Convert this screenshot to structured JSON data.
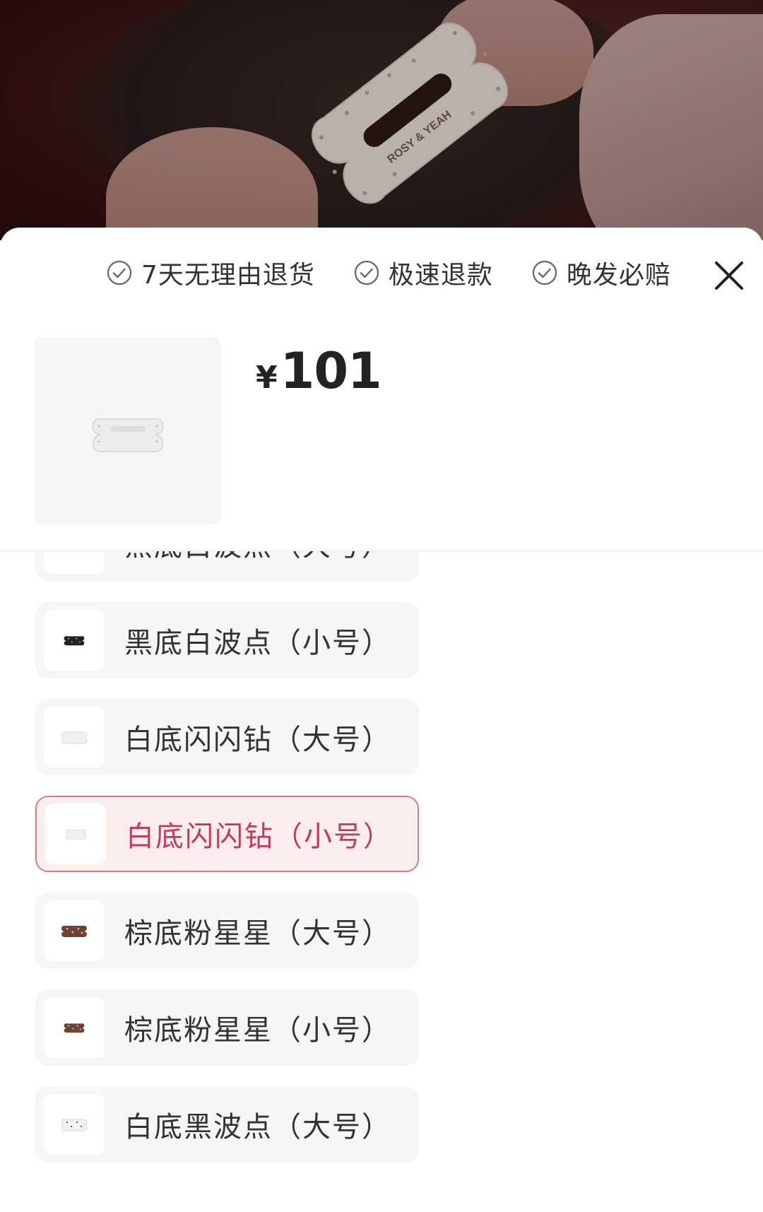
{
  "guarantees": [
    "7天无理由退货",
    "极速退款",
    "晚发必赔"
  ],
  "hero_clip_text": "ROSY & YEAH",
  "product": {
    "currency": "¥",
    "price": "101"
  },
  "options": [
    {
      "label": "黑底白波点（大号）",
      "swatch": "black"
    },
    {
      "label": "黑底白波点（小号）",
      "swatch": "black"
    },
    {
      "label": "白底闪闪钻（大号）",
      "swatch": "white"
    },
    {
      "label": "白底闪闪钻（小号）",
      "swatch": "white",
      "selected": true
    },
    {
      "label": "棕底粉星星（大号）",
      "swatch": "brown"
    },
    {
      "label": "棕底粉星星（小号）",
      "swatch": "brown"
    },
    {
      "label": "白底黑波点（大号）",
      "swatch": "white-dots"
    }
  ],
  "colors": {
    "accent": "#c53a5a",
    "selected_bg": "#fdeeee",
    "selected_border": "#d97b86"
  }
}
